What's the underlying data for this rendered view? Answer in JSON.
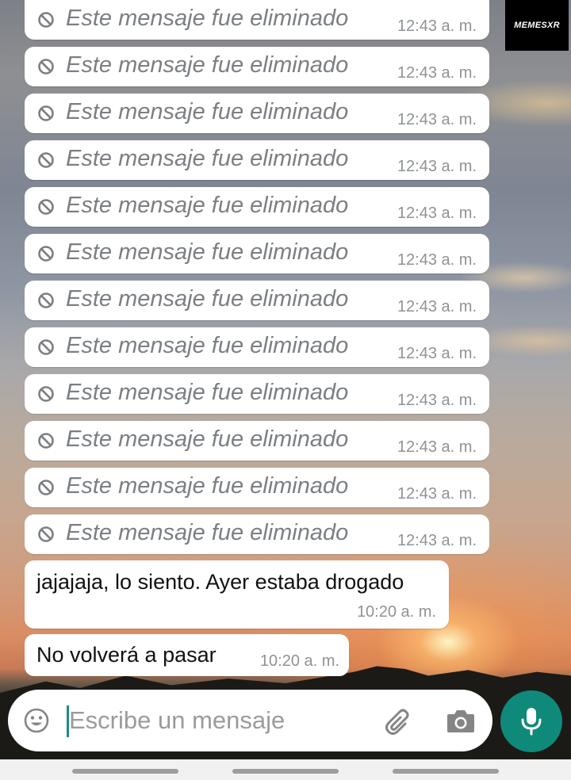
{
  "watermark": "MEMESXR",
  "deleted_messages": [
    {
      "text": "Este mensaje fue eliminado",
      "time": "12:43 a. m."
    },
    {
      "text": "Este mensaje fue eliminado",
      "time": "12:43 a. m."
    },
    {
      "text": "Este mensaje fue eliminado",
      "time": "12:43 a. m."
    },
    {
      "text": "Este mensaje fue eliminado",
      "time": "12:43 a. m."
    },
    {
      "text": "Este mensaje fue eliminado",
      "time": "12:43 a. m."
    },
    {
      "text": "Este mensaje fue eliminado",
      "time": "12:43 a. m."
    },
    {
      "text": "Este mensaje fue eliminado",
      "time": "12:43 a. m."
    },
    {
      "text": "Este mensaje fue eliminado",
      "time": "12:43 a. m."
    },
    {
      "text": "Este mensaje fue eliminado",
      "time": "12:43 a. m."
    },
    {
      "text": "Este mensaje fue eliminado",
      "time": "12:43 a. m."
    },
    {
      "text": "Este mensaje fue eliminado",
      "time": "12:43 a. m."
    },
    {
      "text": "Este mensaje fue eliminado",
      "time": "12:43 a. m."
    }
  ],
  "messages": [
    {
      "text": "jajajaja, lo siento. Ayer estaba drogado",
      "time": "10:20 a. m."
    },
    {
      "text": "No volverá a pasar",
      "time": "10:20 a. m."
    }
  ],
  "composer": {
    "placeholder": "Escribe un mensaje",
    "value": ""
  },
  "icons": {
    "deleted": "block-icon",
    "emoji": "emoji-icon",
    "attach": "paperclip-icon",
    "camera": "camera-icon",
    "mic": "microphone-icon"
  },
  "colors": {
    "accent": "#0f8a7a",
    "bubble": "#ffffff",
    "deleted_text": "#7b7f83",
    "timestamp": "#8f9396"
  }
}
